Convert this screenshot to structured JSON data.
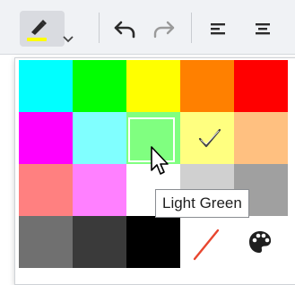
{
  "toolbar": {
    "highlight_color": "#ffff00",
    "buttons": [
      {
        "name": "highlighter-icon"
      },
      {
        "name": "chevron-down-icon"
      },
      {
        "name": "undo-icon"
      },
      {
        "name": "redo-icon"
      },
      {
        "name": "align-left-icon"
      },
      {
        "name": "align-center-icon"
      }
    ]
  },
  "palette": {
    "selected_index": 8,
    "hovered_index": 7,
    "hovered_label": "Light Green",
    "colors": [
      "#00ffff",
      "#00ff00",
      "#ffff00",
      "#ff8000",
      "#ff0000",
      "#ff00ff",
      "#80ffff",
      "#80ff80",
      "#ffff80",
      "#ffc080",
      "#ff8080",
      "#ff80ff",
      "#ffffff",
      "#d0d0d0",
      "#a0a0a0",
      "#707070",
      "#3a3a3a",
      "#000000"
    ],
    "extra_items": [
      "no-color",
      "more-colors"
    ]
  }
}
